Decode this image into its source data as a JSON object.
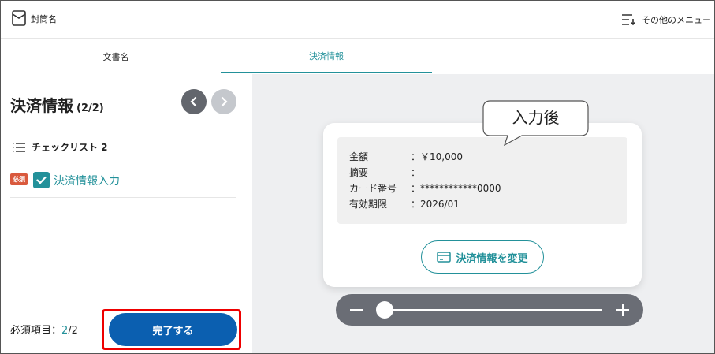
{
  "header": {
    "envelope_name": "封筒名",
    "menu_label": "その他のメニュー"
  },
  "tabs": [
    {
      "label": "文書名"
    },
    {
      "label": "決済情報"
    }
  ],
  "sidebar": {
    "title": "決済情報",
    "page_indicator": "(2/2)",
    "checklist_title": "チェックリスト 2",
    "required_badge": "必須",
    "item_label": "決済情報入力",
    "required_label": "必須項目：",
    "required_done": "2",
    "required_total": "/2",
    "complete_label": "完了する"
  },
  "card": {
    "rows": [
      {
        "key": "金額",
        "value": "：￥10,000"
      },
      {
        "key": "摘要",
        "value": "："
      },
      {
        "key": "カード番号",
        "value": "：************0000"
      },
      {
        "key": "有効期限",
        "value": "：2026/01"
      }
    ],
    "change_button": "決済情報を変更",
    "callout": "入力後"
  },
  "colors": {
    "accent": "#23919a",
    "primary_button": "#0b5fb0",
    "highlight_outline": "#ee0000",
    "required_badge": "#d9593d"
  }
}
